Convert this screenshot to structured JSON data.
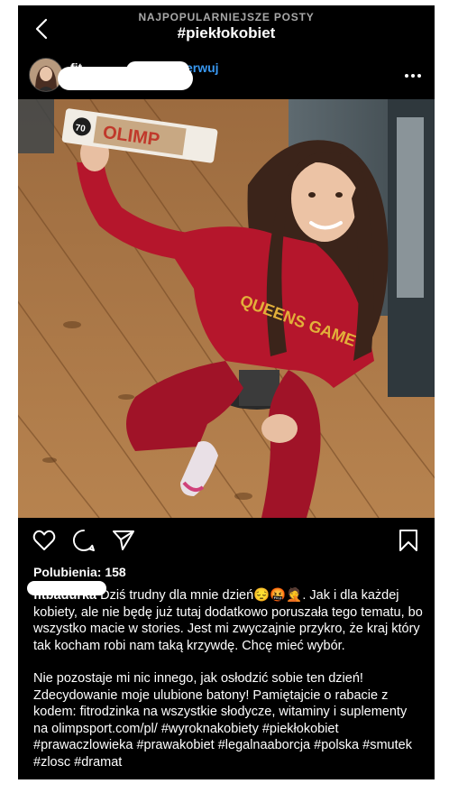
{
  "topbar": {
    "subtitle": "NAJPOPULARNIEJSZE POSTY",
    "title": "#piekłokobiet",
    "back_icon": "chevron-left-icon"
  },
  "post_header": {
    "username_visible": "fit",
    "follow_visible": "erwuj",
    "more_icon": "ellipsis-icon"
  },
  "photo": {
    "bar_brand": "OLIMP",
    "bar_weight": "70"
  },
  "actions": {
    "like_icon": "heart-icon",
    "comment_icon": "comment-icon",
    "share_icon": "send-icon",
    "save_icon": "bookmark-icon"
  },
  "likes": {
    "text": "Polubienia: 158"
  },
  "caption": {
    "username": "fitbadurka",
    "p1": "Dziś trudny dla mnie dzień😔🤬🤦. Jak i dla każdej kobiety, ale nie będę już tutaj dodatkowo poruszała tego tematu, bo wszystko macie w stories. Jest mi zwyczajnie przykro, że kraj który tak kocham robi nam taką krzywdę. Chcę mieć wybór.",
    "p2": "Nie pozostaje mi nic innego, jak osłodzić sobie ten dzień! Zdecydowanie moje ulubione batony! Pamiętajcie o rabacie z kodem: fitrodzinka na wszystkie słodycze, witaminy i suplementy na olimpsport.com/pl/ #wyroknakobiety #piekłokobiet #prawaczlowieka #prawakobiet #legalnaaborcja #polska #smutek #zlosc #dramat"
  },
  "colors": {
    "background": "#000000",
    "link": "#3897f0",
    "muted": "#a8a8a8"
  }
}
